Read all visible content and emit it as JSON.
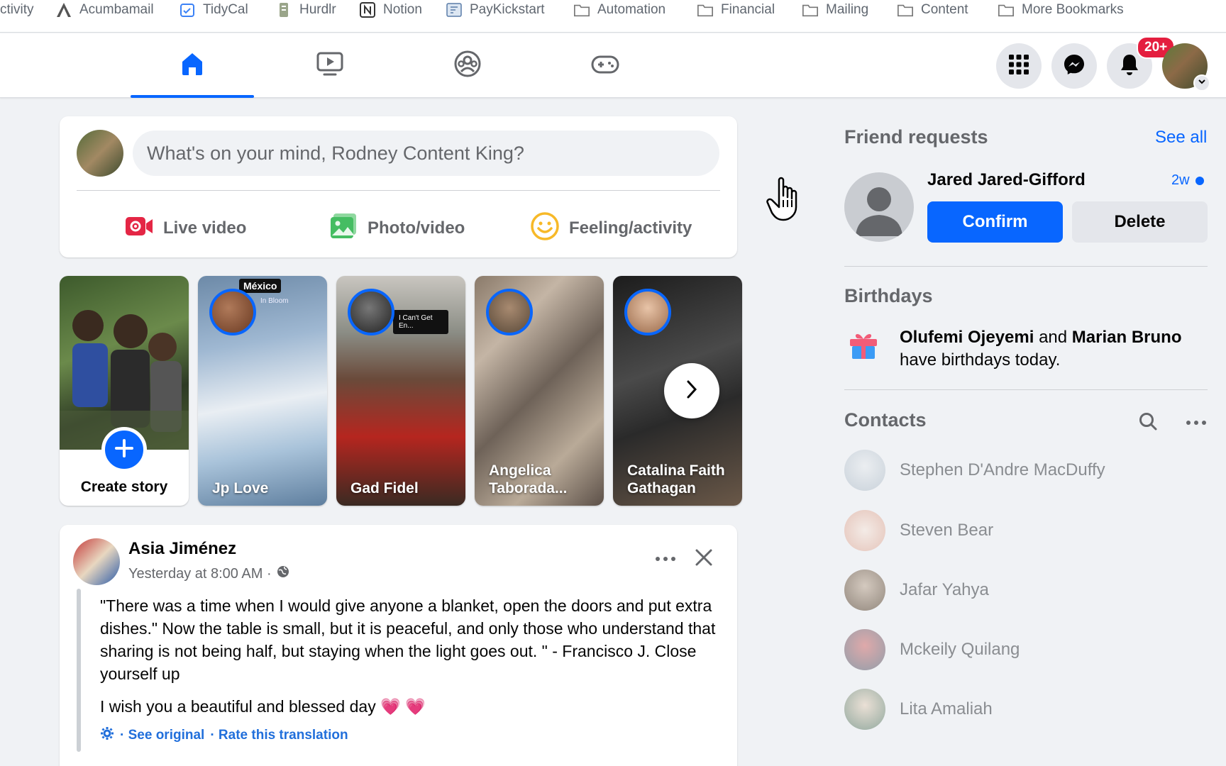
{
  "bookmarks": [
    {
      "label": "ctivity",
      "icon": "partial"
    },
    {
      "label": "Acumbamail",
      "icon": "acumbamail-icon"
    },
    {
      "label": "TidyCal",
      "icon": "tidycal-icon"
    },
    {
      "label": "Hurdlr",
      "icon": "hurdlr-icon"
    },
    {
      "label": "Notion",
      "icon": "notion-icon"
    },
    {
      "label": "PayKickstart",
      "icon": "paykickstart-icon"
    },
    {
      "label": "Automation",
      "icon": "folder-icon"
    },
    {
      "label": "Financial",
      "icon": "folder-icon"
    },
    {
      "label": "Mailing",
      "icon": "folder-icon"
    },
    {
      "label": "Content",
      "icon": "folder-icon"
    },
    {
      "label": "More Bookmarks",
      "icon": "folder-icon"
    }
  ],
  "nav": {
    "notification_badge": "20+",
    "accent": "#0866ff"
  },
  "composer": {
    "placeholder": "What's on your mind, Rodney Content King?",
    "actions": [
      {
        "label": "Live video",
        "color": "#e42645"
      },
      {
        "label": "Photo/video",
        "color": "#45bd62"
      },
      {
        "label": "Feeling/activity",
        "color": "#f7b928"
      }
    ]
  },
  "stories": {
    "create_label": "Create story",
    "items": [
      {
        "name": "Jp Love",
        "overlay_top": "México",
        "overlay_small": "In Bloom"
      },
      {
        "name": "Gad Fidel",
        "overlay_small": "I Can't Get En..."
      },
      {
        "name": "Angelica Taborada..."
      },
      {
        "name": "Catalina Faith Gathagan"
      }
    ]
  },
  "post": {
    "author": "Asia Jiménez",
    "time": "Yesterday at 8:00 AM ·",
    "text": "\"There was a time when I would give anyone a blanket, open the doors and put extra dishes.\" Now the table is small, but it is peaceful, and only those who understand that sharing is not being half, but staying when the light goes out. \" - Francisco J. Close yourself up",
    "wish": "I wish you a beautiful and blessed day 💗 💗",
    "see_original": "· See original",
    "rate_translation": "· Rate this translation"
  },
  "friend_requests": {
    "heading": "Friend requests",
    "see_all": "See all",
    "name": "Jared Jared-Gifford",
    "time": "2w",
    "confirm": "Confirm",
    "delete": "Delete"
  },
  "birthdays": {
    "heading": "Birthdays",
    "name1": "Olufemi Ojeyemi",
    "and": " and ",
    "name2": "Marian Bruno",
    "suffix": "have birthdays today."
  },
  "contacts": {
    "heading": "Contacts",
    "items": [
      "Stephen D'Andre MacDuffy",
      "Steven Bear",
      "Jafar Yahya",
      "Mckeily Quilang",
      "Lita Amaliah"
    ]
  }
}
